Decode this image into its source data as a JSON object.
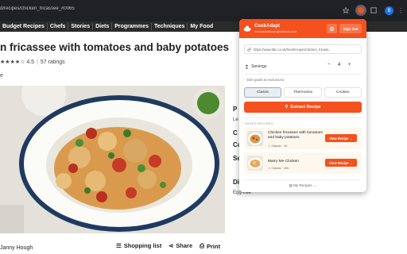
{
  "browser": {
    "url": "d/recipes/chicken_fricassee_#0065",
    "profile_initial": "B"
  },
  "nav_items": [
    "Budget Recipes",
    "Chefs",
    "Stories",
    "Diets",
    "Programmes",
    "Techniques",
    "My Food"
  ],
  "recipe": {
    "title": "n fricassee with tomatoes and baby potatoes",
    "rating": "4.5",
    "ratings_count": "57 ratings",
    "meta_fragment": "e",
    "author": "Janny Hough",
    "actions": {
      "shopping": "Shopping list",
      "share": "Share",
      "print": "Print"
    }
  },
  "sidebar_fragments": {
    "p1": "P",
    "l1": "Le",
    "c1": "C",
    "c2": "Co",
    "s1": "Se",
    "d1": "Di",
    "egg": "Egg-free"
  },
  "popup": {
    "brand": "CookAdapt",
    "email": "mounachahnan@outlook.com",
    "sign_out": "Sign Out",
    "url_value": "https://www.bbc.co.uk/food/recipes/chicken_fricass...",
    "servings_label": "Servings",
    "servings_value": "4",
    "goals_label": "Diet goals & exclusions",
    "modes": [
      {
        "label": "Classic",
        "selected": true
      },
      {
        "label": "Thermomix",
        "selected": false
      },
      {
        "label": "Cookeo",
        "selected": false
      }
    ],
    "extract_label": "Extract Recipe",
    "saved_heading": "SAVED RECIPES",
    "saved": [
      {
        "name": "Chicken fricassee with tomatoes and baby potatoes",
        "mode": "Classic",
        "time": "1h",
        "button": "View Recipe →"
      },
      {
        "name": "Marry Me Chicken",
        "mode": "Classic",
        "time": "40h",
        "button": "View Recipe →"
      }
    ],
    "my_recipes": "My Recipes →"
  },
  "colors": {
    "accent": "#f4511e",
    "chrome": "#202124",
    "nav": "#2b2b2b"
  }
}
